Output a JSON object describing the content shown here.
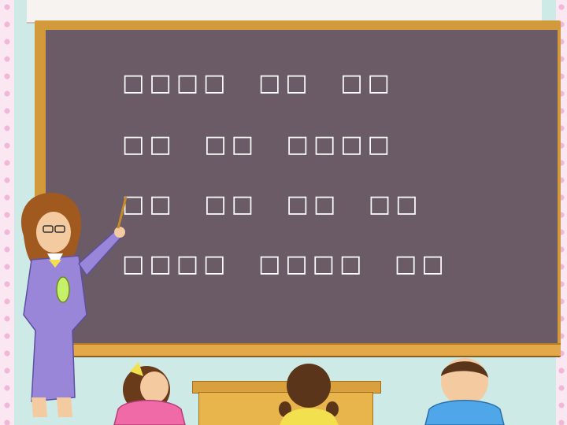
{
  "board": {
    "line1": [
      "□□□□",
      "□□",
      "□□"
    ],
    "line2": [
      "□□",
      "□□",
      "□□□□"
    ],
    "line3": [
      "□□",
      "□□",
      "□□",
      "□□"
    ],
    "line4": [
      "□□□□",
      "□□□□",
      "□□"
    ]
  },
  "colors": {
    "board": "#6a5b66",
    "frame": "#d39a3b",
    "wall": "#cdeae7",
    "teacher_dress": "#9a86d8",
    "girl_shirt": "#f06aa8",
    "boy_shirt": "#4fa6e8"
  }
}
